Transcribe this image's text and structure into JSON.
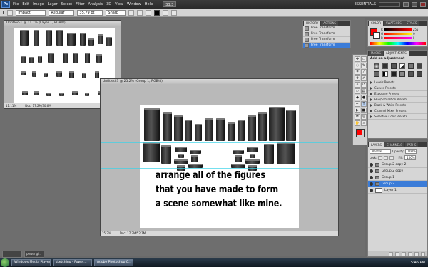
{
  "app": {
    "logo": "Ps",
    "menu": [
      "File",
      "Edit",
      "Image",
      "Layer",
      "Select",
      "Filter",
      "Analysis",
      "3D",
      "View",
      "Window",
      "Help"
    ],
    "zoom": "33.3",
    "workspace": "ESSENTIALS"
  },
  "options": {
    "font_family": "Impact",
    "font_style": "Regular",
    "font_size": "35.79 pt",
    "antialias": "Sharp"
  },
  "doc1": {
    "title": "Untitled-1 @ 11.1% (Layer 1, RGB/8)",
    "zoom": "11.11%",
    "doc_size": "Doc: 17.2M/30.6M"
  },
  "doc2": {
    "title": "Untitled-3 @ 25.2% (Group 1, RGB/8)",
    "zoom": "25.2%",
    "doc_size": "Doc: 17.2M/52.7M"
  },
  "caption": [
    "arrange all of the figures",
    "that you have made to form",
    "a scene somewhat like mine."
  ],
  "history": {
    "tabs": [
      "HISTORY",
      "ACTIONS"
    ],
    "items": [
      "Free Transform",
      "Free Transform",
      "Free Transform",
      "Free Transform"
    ]
  },
  "color": {
    "tabs": [
      "COLOR",
      "SWATCHES",
      "STYLES"
    ],
    "channels": [
      "R",
      "G",
      "B"
    ],
    "values": [
      "255",
      "0",
      "0"
    ]
  },
  "adjustments": {
    "tabs": [
      "MASKS",
      "ADJUSTMENTS"
    ],
    "heading": "Add an adjustment",
    "presets": [
      "Levels Presets",
      "Curves Presets",
      "Exposure Presets",
      "Hue/Saturation Presets",
      "Black & White Presets",
      "Channel Mixer Presets",
      "Selective Color Presets"
    ]
  },
  "layers": {
    "tabs": [
      "LAYERS",
      "CHANNELS",
      "PATHS"
    ],
    "blend_mode": "Normal",
    "opacity_label": "Opacity:",
    "opacity": "100%",
    "lock_label": "Lock:",
    "fill_label": "Fill:",
    "fill": "100%",
    "items": [
      "Group 2 copy 2",
      "Group 2 copy",
      "Group 1",
      "Group 2",
      "Layer 1"
    ]
  },
  "taskbar": {
    "items": [
      "Windows Media Player",
      "sketching - Power...",
      "Adobe Photoshop C..."
    ],
    "thumbs": [
      "",
      "power gi..."
    ],
    "clock": "5:45 PM"
  },
  "colors": {
    "accent": "#3b7cd8",
    "foreground": "#ff0000",
    "background": "#ffffff",
    "guide": "#3ad3e8"
  }
}
